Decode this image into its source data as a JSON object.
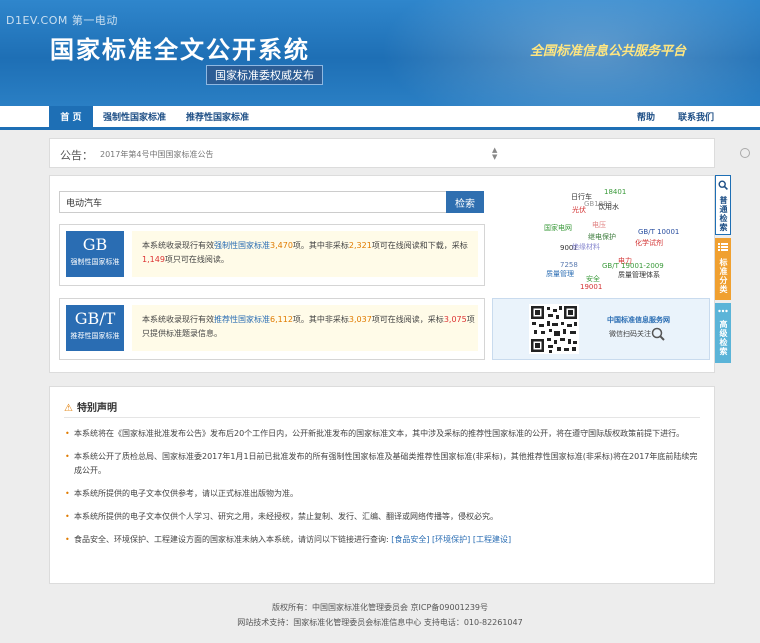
{
  "header": {
    "watermark": "D1EV.COM 第一电动",
    "title": "国家标准全文公开系统",
    "subtitle": "国家标准委权威发布",
    "slogan": "全国标准信息公共服务平台"
  },
  "nav": {
    "home": "首 页",
    "mandatory": "强制性国家标准",
    "recommended": "推荐性国家标准",
    "help": "帮助",
    "contact": "联系我们"
  },
  "notice": {
    "label": "公告：",
    "text": "2017年第4号中国国家标准公告"
  },
  "search": {
    "value": "电动汽车",
    "button": "检索"
  },
  "gb": {
    "code": "GB",
    "name": "强制性国家标准",
    "p1": "本系统收录现行有效",
    "link": "强制性国家标准",
    "count": "3,470",
    "p2": "项。其中非采标",
    "nonadopt": "2,321",
    "p3": "项可在线阅读和下载，采标",
    "adopt": "1,149",
    "p4": "项只可在线阅读。"
  },
  "gbt": {
    "code": "GB/T",
    "name": "推荐性国家标准",
    "p1": "本系统收录现行有效",
    "link": "推荐性国家标准",
    "count": "6,112",
    "p2": "项。其中非采标",
    "nonadopt": "3,037",
    "p3": "项可在线阅读，采标",
    "adopt": "3,075",
    "p4": "项只提供标准题录信息。"
  },
  "cloud": [
    {
      "t": "日行车",
      "c": "#333333"
    },
    {
      "t": "18401",
      "c": "#3a9a3a"
    },
    {
      "t": "GB1883",
      "c": "#999999"
    },
    {
      "t": "光伏",
      "c": "#d33333"
    },
    {
      "t": "饮用水",
      "c": "#333333"
    },
    {
      "t": "电压",
      "c": "#e08080"
    },
    {
      "t": "国家电网",
      "c": "#3a9a3a"
    },
    {
      "t": "继电保护",
      "c": "#3a7a3a"
    },
    {
      "t": "GB/T 10001",
      "c": "#2a4fa0"
    },
    {
      "t": "化学试剂",
      "c": "#d33333"
    },
    {
      "t": "9001",
      "c": "#333333"
    },
    {
      "t": "绝缘材料",
      "c": "#8a8ad0"
    },
    {
      "t": "电力",
      "c": "#d33333"
    },
    {
      "t": "7258",
      "c": "#5a7ab0"
    },
    {
      "t": "GB/T 19001-2009",
      "c": "#3a9a3a"
    },
    {
      "t": "质量管理",
      "c": "#2a6db3"
    },
    {
      "t": "安全",
      "c": "#3a9a3a"
    },
    {
      "t": "质量管理体系",
      "c": "#333333"
    },
    {
      "t": "19001",
      "c": "#d33333"
    }
  ],
  "qr": {
    "title": "中国标准信息服务网",
    "sub": "微信扫码关注"
  },
  "side": {
    "search": "普通检索",
    "classify": "标准分类",
    "advanced": "高级检索"
  },
  "statement": {
    "title": "特别声明",
    "items": [
      "本系统将在《国家标准批准发布公告》发布后20个工作日内，公开新批准发布的国家标准文本，其中涉及采标的推荐性国家标准的公开，将在遵守国际版权政策前提下进行。",
      "本系统公开了质检总局、国家标准委2017年1月1日前已批准发布的所有强制性国家标准及基础类推荐性国家标准(非采标)，其他推荐性国家标准(非采标)将在2017年底前陆续完成公开。",
      "本系统所提供的电子文本仅供参考，请以正式标准出版物为准。",
      "本系统所提供的电子文本仅供个人学习、研究之用，未经授权，禁止复制、发行、汇编、翻译或网络传播等，侵权必究。"
    ],
    "last": "食品安全、环境保护、工程建设方面的国家标准未纳入本系统，请访问以下链接进行查询:",
    "links": [
      "[食品安全]",
      "[环境保护]",
      "[工程建设]"
    ]
  },
  "footer": {
    "line1": "版权所有：中国国家标准化管理委员会 京ICP备09001239号",
    "line2": "网站技术支持：国家标准化管理委员会标准信息中心 支持电话：010-82261047"
  },
  "colors": {
    "primary": "#1e6fb5",
    "badge": "#2a6db3",
    "orange": "#f0a030",
    "cyan": "#5bb4d8"
  }
}
